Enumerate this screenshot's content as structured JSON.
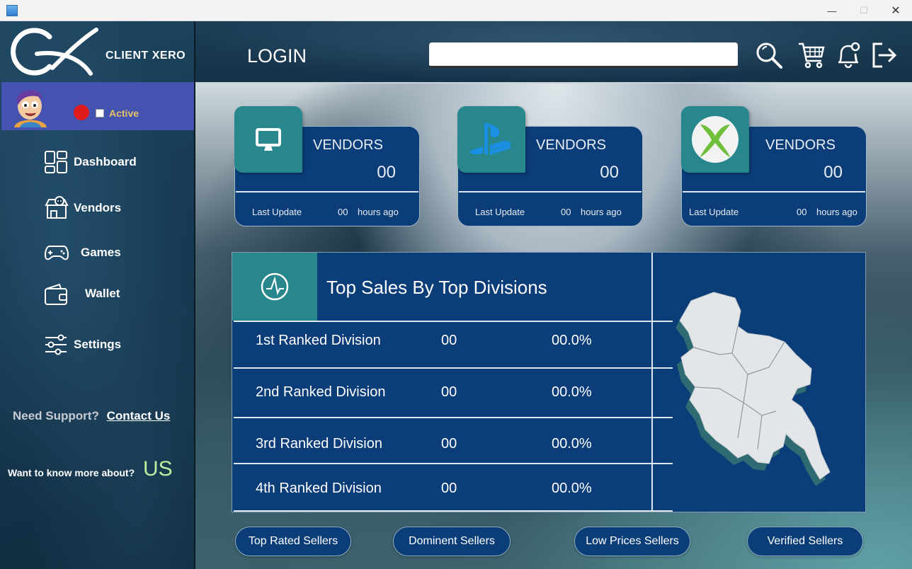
{
  "window": {
    "minimize_glyph": "—",
    "maximize_glyph": "☐",
    "close_glyph": "✕"
  },
  "sidebar": {
    "brand": "CLIENT XERO",
    "status_label": "Active",
    "status_color": "#e01b1b",
    "items": [
      {
        "label": "Dashboard",
        "icon": "dashboard-icon"
      },
      {
        "label": "Vendors",
        "icon": "store-icon"
      },
      {
        "label": "Games",
        "icon": "gamepad-icon"
      },
      {
        "label": "Wallet",
        "icon": "wallet-icon"
      },
      {
        "label": "Settings",
        "icon": "sliders-icon"
      }
    ],
    "support_text": "Need Support?",
    "support_link": "Contact Us",
    "know_more_text": "Want to know more about?",
    "know_more_link": "US"
  },
  "header": {
    "title": "LOGIN",
    "search_value": "",
    "icons": [
      "search-icon",
      "cart-icon",
      "bell-icon",
      "logout-icon"
    ]
  },
  "cards": [
    {
      "platform_icon": "monitor-icon",
      "label": "VENDORS",
      "count": "00",
      "last_update": "Last Update",
      "hours": "00",
      "hours_label": "hours ago"
    },
    {
      "platform_icon": "playstation-icon",
      "label": "VENDORS",
      "count": "00",
      "last_update": "Last Update",
      "hours": "00",
      "hours_label": "hours ago"
    },
    {
      "platform_icon": "xbox-icon",
      "label": "VENDORS",
      "count": "00",
      "last_update": "Last Update",
      "hours": "00",
      "hours_label": "hours ago"
    }
  ],
  "top_sales": {
    "title": "Top Sales By Top Divisions",
    "rows": [
      {
        "name": "1st Ranked Division",
        "count": "00",
        "pct": "00.0%"
      },
      {
        "name": "2nd Ranked Division",
        "count": "00",
        "pct": "00.0%"
      },
      {
        "name": "3rd Ranked Division",
        "count": "00",
        "pct": "00.0%"
      },
      {
        "name": "4th Ranked Division",
        "count": "00",
        "pct": "00.0%"
      }
    ]
  },
  "buttons": {
    "top_rated": "Top Rated Sellers",
    "dominent": "Dominent Sellers",
    "low_prices": "Low Prices Sellers",
    "verified": "Verified Sellers"
  },
  "colors": {
    "panel": "#0b3d79",
    "accent_tile": "#28878d",
    "profile_bar": "#4553b0"
  }
}
